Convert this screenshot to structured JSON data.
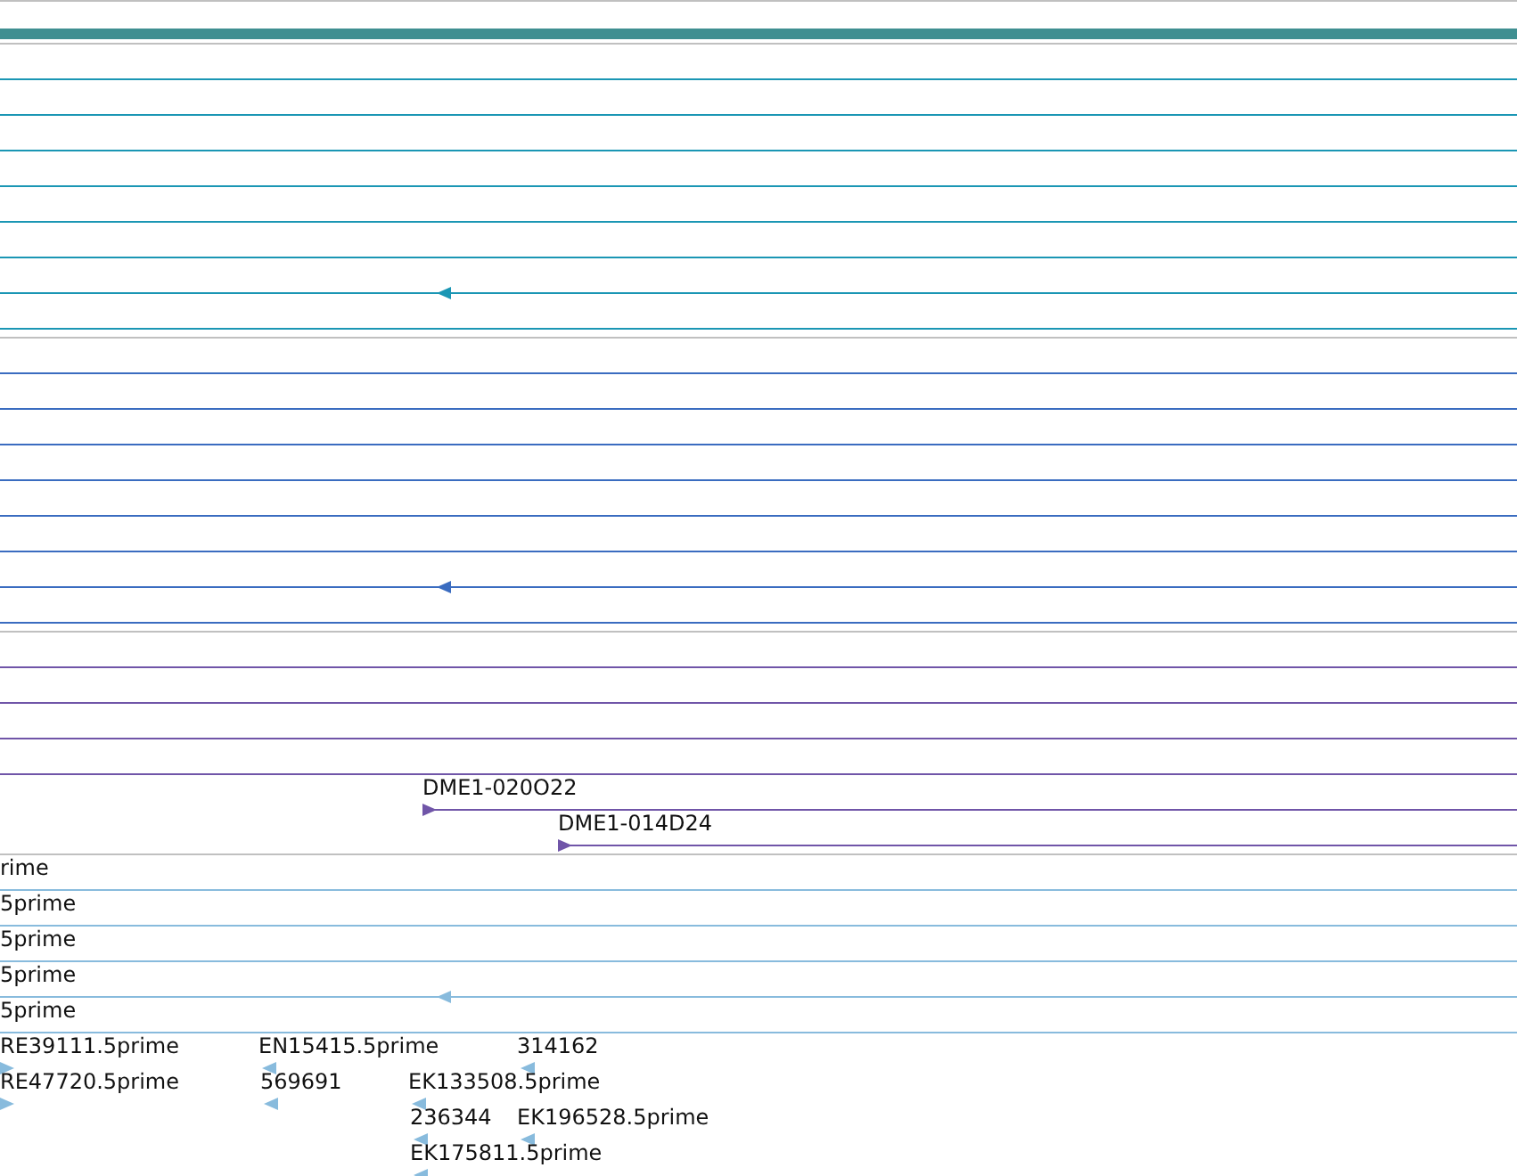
{
  "tracks": [
    {
      "color": "#1a96b4",
      "rows": [
        [
          {
            "kind": "span",
            "arrow": false
          }
        ],
        [
          {
            "kind": "span",
            "arrow": false
          }
        ],
        [
          {
            "kind": "span",
            "arrow": false
          }
        ],
        [
          {
            "kind": "span",
            "arrow": false
          }
        ],
        [
          {
            "kind": "span",
            "arrow": false
          }
        ],
        [
          {
            "kind": "span",
            "arrow": false
          }
        ],
        [
          {
            "kind": "span",
            "arrow": true,
            "reverse": true
          }
        ],
        [
          {
            "kind": "span",
            "arrow": false
          }
        ]
      ]
    },
    {
      "color": "#3a6cc0",
      "rows": [
        [
          {
            "kind": "span",
            "arrow": false
          }
        ],
        [
          {
            "kind": "span",
            "arrow": false
          }
        ],
        [
          {
            "kind": "span",
            "arrow": false
          }
        ],
        [
          {
            "kind": "span",
            "arrow": false
          }
        ],
        [
          {
            "kind": "span",
            "arrow": false
          }
        ],
        [
          {
            "kind": "span",
            "arrow": false
          }
        ],
        [
          {
            "kind": "span",
            "arrow": true,
            "reverse": true
          }
        ],
        [
          {
            "kind": "span",
            "arrow": false
          }
        ]
      ]
    },
    {
      "color": "#7055a8",
      "rows": [
        [
          {
            "kind": "span",
            "arrow": false
          }
        ],
        [
          {
            "kind": "span",
            "arrow": false
          }
        ],
        [
          {
            "kind": "span",
            "arrow": false
          }
        ],
        [
          {
            "kind": "span",
            "arrow": false
          }
        ],
        [
          {
            "kind": "span",
            "arrow": true,
            "reverse": false,
            "label": "DME1-020O22"
          }
        ],
        [
          {
            "kind": "span",
            "arrow": true,
            "reverse": false,
            "label": "DME1-014D24"
          }
        ]
      ]
    },
    {
      "color": "#88bbdd",
      "rows": [
        [
          {
            "kind": "span",
            "arrow": false,
            "label": "rime"
          }
        ],
        [
          {
            "kind": "span",
            "arrow": false,
            "label": "5prime"
          }
        ],
        [
          {
            "kind": "span",
            "arrow": false,
            "label": "5prime"
          }
        ],
        [
          {
            "kind": "span",
            "arrow": true,
            "reverse": true,
            "label": "5prime"
          }
        ],
        [
          {
            "kind": "span",
            "arrow": false,
            "label": "5prime"
          }
        ],
        [
          {
            "kind": "point",
            "reverse": false,
            "label": "RE39111.5prime"
          },
          {
            "kind": "point",
            "reverse": true,
            "label": "EN15415.5prime"
          },
          {
            "kind": "point",
            "reverse": true,
            "label": "314162"
          }
        ],
        [
          {
            "kind": "point",
            "reverse": false,
            "label": "RE47720.5prime"
          },
          {
            "kind": "point",
            "reverse": true,
            "label": "569691"
          },
          {
            "kind": "point",
            "reverse": true,
            "label": "EK133508.5prime"
          }
        ],
        [
          {
            "kind": "point",
            "reverse": true,
            "label": "236344"
          },
          {
            "kind": "point",
            "reverse": true,
            "label": "EK196528.5prime"
          }
        ],
        [
          {
            "kind": "point",
            "reverse": true,
            "label": "EK175811.5prime"
          }
        ]
      ]
    }
  ]
}
